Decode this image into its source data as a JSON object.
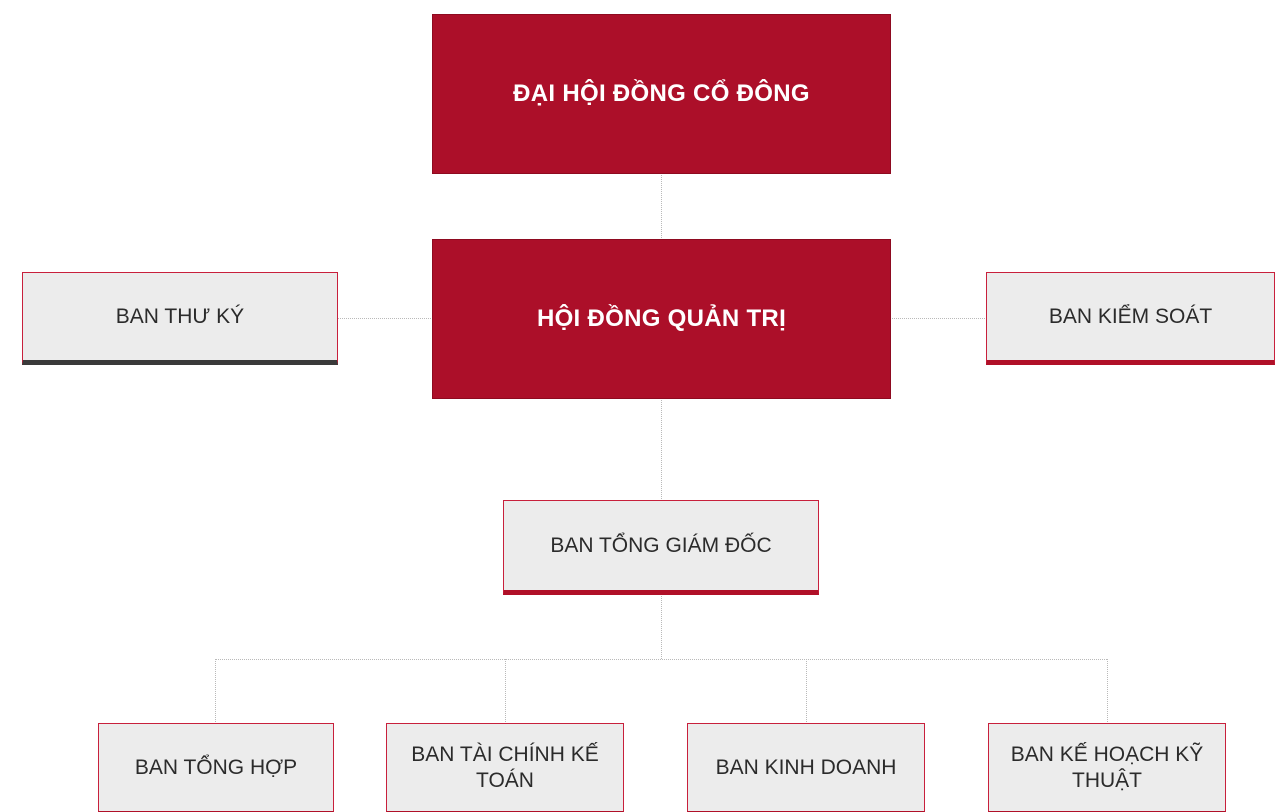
{
  "diagram": {
    "top": {
      "label": "ĐẠI HỘI ĐỒNG CỔ ĐÔNG"
    },
    "board": {
      "label": "HỘI ĐỒNG QUẢN TRỊ"
    },
    "secretariat": {
      "label": "BAN THƯ KÝ"
    },
    "supervisory": {
      "label": "BAN KIỂM SOÁT"
    },
    "executive": {
      "label": "BAN TỔNG GIÁM ĐỐC"
    },
    "departments": [
      {
        "label": "BAN TỔNG HỢP"
      },
      {
        "label": "BAN TÀI CHÍNH KẾ TOÁN"
      },
      {
        "label": "BAN KINH DOANH"
      },
      {
        "label": "BAN KẾ HOẠCH KỸ THUẬT"
      }
    ]
  },
  "colors": {
    "primary_red": "#ac0f29",
    "box_gray": "#ececec",
    "accent_dark": "#3a3a3a",
    "connector": "#b9b9b9"
  }
}
